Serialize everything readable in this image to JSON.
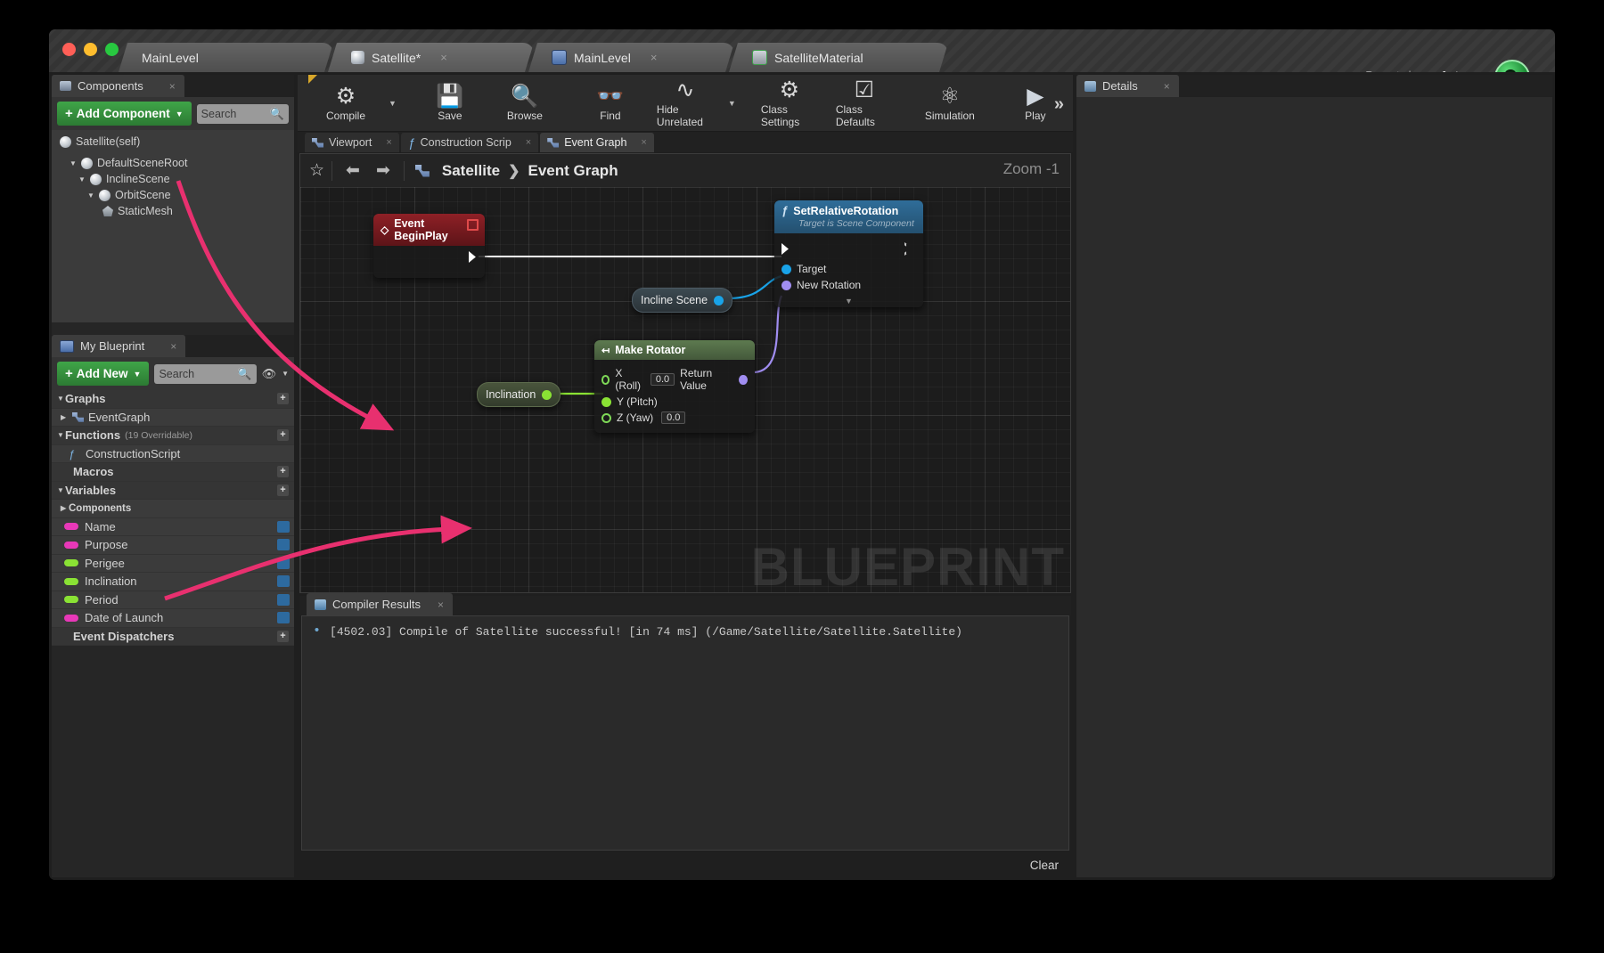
{
  "window": {
    "tabs": [
      {
        "label": "MainLevel",
        "icon": "level-icon",
        "selected": false,
        "closable": false
      },
      {
        "label": "Satellite*",
        "icon": "blueprint-sphere-icon",
        "selected": true,
        "closable": true
      },
      {
        "label": "MainLevel",
        "icon": "level-book-icon",
        "selected": false,
        "closable": true
      },
      {
        "label": "SatelliteMaterial",
        "icon": "material-icon",
        "selected": false,
        "closable": true
      }
    ],
    "parent_class_label": "Parent class:",
    "parent_class_value": "Actor"
  },
  "toolbar": {
    "buttons": [
      {
        "label": "Compile",
        "icon": "compile-gears-check-icon",
        "has_caret": true
      },
      {
        "label": "Save",
        "icon": "floppy-disk-icon",
        "has_caret": false
      },
      {
        "label": "Browse",
        "icon": "magnifier-icon",
        "has_caret": false
      },
      {
        "label": "Find",
        "icon": "binoculars-icon",
        "has_caret": false
      },
      {
        "label": "Hide Unrelated",
        "icon": "node-graph-icon",
        "has_caret": true
      },
      {
        "label": "Class Settings",
        "icon": "gear-window-icon",
        "has_caret": false
      },
      {
        "label": "Class Defaults",
        "icon": "checklist-icon",
        "has_caret": false
      },
      {
        "label": "Simulation",
        "icon": "gear-play-icon",
        "has_caret": false
      },
      {
        "label": "Play",
        "icon": "play-triangle-icon",
        "has_caret": true
      }
    ],
    "overflow_label": "»"
  },
  "components_panel": {
    "tab_label": "Components",
    "tab_icon": "components-icon",
    "add_button": "Add Component",
    "add_button_plus": "+",
    "search_placeholder": "Search",
    "root_label": "Satellite(self)",
    "tree": [
      {
        "label": "DefaultSceneRoot",
        "depth": 1,
        "icon": "scene-component-icon",
        "expanded": true
      },
      {
        "label": "InclineScene",
        "depth": 2,
        "icon": "scene-component-icon",
        "expanded": true
      },
      {
        "label": "OrbitScene",
        "depth": 3,
        "icon": "scene-component-icon",
        "expanded": true
      },
      {
        "label": "StaticMesh",
        "depth": 4,
        "icon": "static-mesh-icon",
        "expanded": false
      }
    ]
  },
  "my_blueprint_panel": {
    "tab_label": "My Blueprint",
    "tab_icon": "blueprint-book-icon",
    "add_button": "Add New",
    "add_button_plus": "+",
    "search_placeholder": "Search",
    "sections": [
      {
        "label": "Graphs",
        "type": "category",
        "expanded": true,
        "has_plus": true
      },
      {
        "label": "EventGraph",
        "type": "graph",
        "icon": "event-graph-icon",
        "expanded": false
      },
      {
        "label": "Functions",
        "sub": "(19 Overridable)",
        "type": "category",
        "expanded": true,
        "has_plus": true
      },
      {
        "label": "ConstructionScript",
        "type": "function",
        "icon": "construction-script-icon"
      },
      {
        "label": "Macros",
        "type": "category",
        "expanded": false,
        "has_plus": true
      },
      {
        "label": "Variables",
        "type": "category",
        "expanded": true,
        "has_plus": true
      },
      {
        "label": "Components",
        "type": "subcategory",
        "expanded": false
      },
      {
        "label": "Name",
        "type": "variable",
        "color": "#e838b8",
        "has_eye": true
      },
      {
        "label": "Purpose",
        "type": "variable",
        "color": "#e838b8",
        "has_eye": true
      },
      {
        "label": "Perigee",
        "type": "variable",
        "color": "#8ae234",
        "has_eye": true
      },
      {
        "label": "Inclination",
        "type": "variable",
        "color": "#8ae234",
        "has_eye": true
      },
      {
        "label": "Period",
        "type": "variable",
        "color": "#8ae234",
        "has_eye": true
      },
      {
        "label": "Date of Launch",
        "type": "variable",
        "color": "#e838b8",
        "has_eye": true
      },
      {
        "label": "Event Dispatchers",
        "type": "category",
        "expanded": false,
        "has_plus": true
      }
    ]
  },
  "graph_tabs": [
    {
      "label": "Viewport",
      "icon": "viewport-icon",
      "selected": false
    },
    {
      "label": "Construction Scrip",
      "icon": "function-icon",
      "selected": false
    },
    {
      "label": "Event Graph",
      "icon": "event-graph-icon",
      "selected": true
    }
  ],
  "graph_bar": {
    "star_icon": "favorite-star-icon",
    "back_icon": "back-arrow-icon",
    "forward_icon": "forward-arrow-icon",
    "breadcrumb_icon": "event-graph-icon",
    "breadcrumb": [
      "Satellite",
      "Event Graph"
    ],
    "breadcrumb_separator": "❯",
    "zoom_label": "Zoom  -1"
  },
  "graph": {
    "watermark": "BLUEPRINT",
    "nodes": [
      {
        "id": "event-begin-play",
        "title": "Event BeginPlay",
        "kind": "event",
        "title_icon": "event-diamond-icon",
        "badge_icon": "delegate-square-icon",
        "out_exec": "exec-out"
      },
      {
        "id": "set-relative-rotation",
        "title": "SetRelativeRotation",
        "subtitle": "Target is Scene Component",
        "kind": "function",
        "title_icon": "function-f-icon",
        "inputs": [
          {
            "label": "Target",
            "pin": "object",
            "color": "#19a3e8"
          },
          {
            "label": "New Rotation",
            "pin": "struct",
            "color": "#a08df0"
          }
        ],
        "expand_icon": "chevron-down-icon"
      },
      {
        "id": "make-rotator",
        "title": "Make Rotator",
        "kind": "pure",
        "title_icon": "make-struct-icon",
        "inputs": [
          {
            "label": "X (Roll)",
            "value": "0.0",
            "pin": "float-ring",
            "color": "#7ed957"
          },
          {
            "label": "Y (Pitch)",
            "value": "",
            "pin": "float-filled",
            "color": "#7ed957"
          },
          {
            "label": "Z (Yaw)",
            "value": "0.0",
            "pin": "float-ring",
            "color": "#7ed957"
          }
        ],
        "outputs": [
          {
            "label": "Return Value",
            "pin": "struct",
            "color": "#a08df0"
          }
        ]
      }
    ],
    "variable_nodes": [
      {
        "id": "incline-scene",
        "label": "Incline Scene",
        "pin_color": "#19a3e8"
      },
      {
        "id": "inclination",
        "label": "Inclination",
        "pin_color": "#8ae234"
      }
    ],
    "annotations": [
      {
        "name": "arrow-to-incline-scene",
        "from": "InclineScene component",
        "to": "Incline Scene node"
      },
      {
        "name": "arrow-to-inclination",
        "from": "Inclination variable",
        "to": "Inclination node"
      }
    ]
  },
  "compiler_results": {
    "tab_label": "Compiler Results",
    "tab_icon": "compiler-icon",
    "messages": [
      "[4502.03] Compile of Satellite successful! [in 74 ms] (/Game/Satellite/Satellite.Satellite)"
    ],
    "clear_label": "Clear"
  },
  "details_panel": {
    "tab_label": "Details",
    "tab_icon": "details-icon"
  },
  "colors": {
    "accent_green": "#3fa548",
    "annotation_pink": "#e8306f",
    "exec_wire": "#ffffff",
    "object_wire": "#19a3e8",
    "struct_wire": "#a08df0",
    "float_wire": "#8ae234"
  }
}
